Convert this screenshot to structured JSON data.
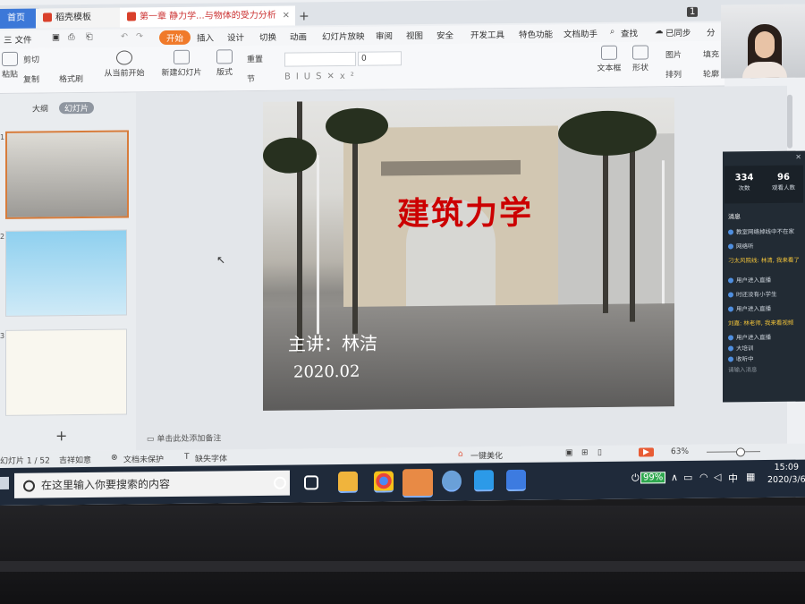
{
  "tabs": {
    "home": "首页",
    "template": "稻壳模板",
    "document": "第一章 静力学...与物体的受力分析",
    "count_badge": "1"
  },
  "menu": {
    "file": "三 文件",
    "items": [
      "开始",
      "插入",
      "设计",
      "切换",
      "动画",
      "幻灯片放映",
      "审阅",
      "视图",
      "安全",
      "开发工具",
      "特色功能",
      "文档助手"
    ],
    "search": "查找",
    "sync": "已同步",
    "share": "分"
  },
  "ribbon": {
    "paste": "粘贴",
    "cut": "剪切",
    "copy": "复制",
    "format_painter": "格式刷",
    "play_from_current": "从当前开始",
    "new_slide": "新建幻灯片",
    "layout": "版式",
    "section": "节",
    "reset": "重置",
    "font_size": "0",
    "text_box": "文本框",
    "shape": "形状",
    "picture": "图片",
    "arrange": "排列",
    "fill": "填充",
    "outline": "轮廓"
  },
  "left_panel": {
    "tab_outline": "大纲",
    "tab_slides": "幻灯片",
    "slide_numbers": [
      "1",
      "2",
      "3"
    ],
    "add": "+"
  },
  "slide": {
    "title": "建筑力学",
    "speaker": "主讲：林洁",
    "date": "2020.02"
  },
  "notes_placeholder": "单击此处添加备注",
  "live": {
    "stat1_value": "334",
    "stat1_label": "次数",
    "stat2_value": "96",
    "stat2_label": "观看人数",
    "header": "消息",
    "messages": [
      "教室网络掉线中不在家",
      "网络听",
      "刁太风院线: 林清, 我来看了",
      "用户进入直播",
      "时还没有小学生",
      "用户进入直播",
      "刘嘉: 林老师, 我来看视频",
      "用户进入直播",
      "大培训",
      "收听中"
    ],
    "input_placeholder": "请输入消息",
    "close": "×"
  },
  "status": {
    "slide_info": "幻灯片 1 / 52",
    "theme": "吉祥如意",
    "protect": "文档未保护",
    "font_missing": "缺失字体",
    "beautify": "一键美化",
    "zoom": "63%"
  },
  "taskbar": {
    "search_placeholder": "在这里输入你要搜索的内容",
    "battery": "99%",
    "ime": "中",
    "time": "15:09",
    "date": "2020/3/6"
  },
  "colors": {
    "accent": "#f07a2a",
    "title_red": "#cc0000",
    "taskbar": "#1f2a3a"
  }
}
